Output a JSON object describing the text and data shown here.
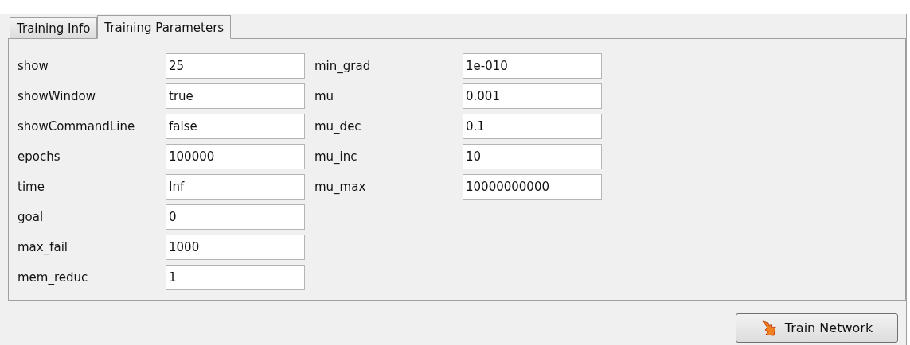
{
  "tabs": [
    {
      "label": "Training Info",
      "selected": false
    },
    {
      "label": "Training Parameters",
      "selected": true
    }
  ],
  "parameter_columns": [
    {
      "parameters": [
        {
          "label": "show",
          "value": "25"
        },
        {
          "label": "showWindow",
          "value": "true"
        },
        {
          "label": "showCommandLine",
          "value": "false"
        },
        {
          "label": "epochs",
          "value": "100000"
        },
        {
          "label": "time",
          "value": "Inf"
        },
        {
          "label": "goal",
          "value": "0"
        },
        {
          "label": "max_fail",
          "value": "1000"
        },
        {
          "label": "mem_reduc",
          "value": "1"
        }
      ]
    },
    {
      "parameters": [
        {
          "label": "min_grad",
          "value": "1e-010"
        },
        {
          "label": "mu",
          "value": "0.001"
        },
        {
          "label": "mu_dec",
          "value": "0.1"
        },
        {
          "label": "mu_inc",
          "value": "10"
        },
        {
          "label": "mu_max",
          "value": "10000000000"
        }
      ]
    }
  ],
  "button": {
    "label": "Train Network"
  }
}
